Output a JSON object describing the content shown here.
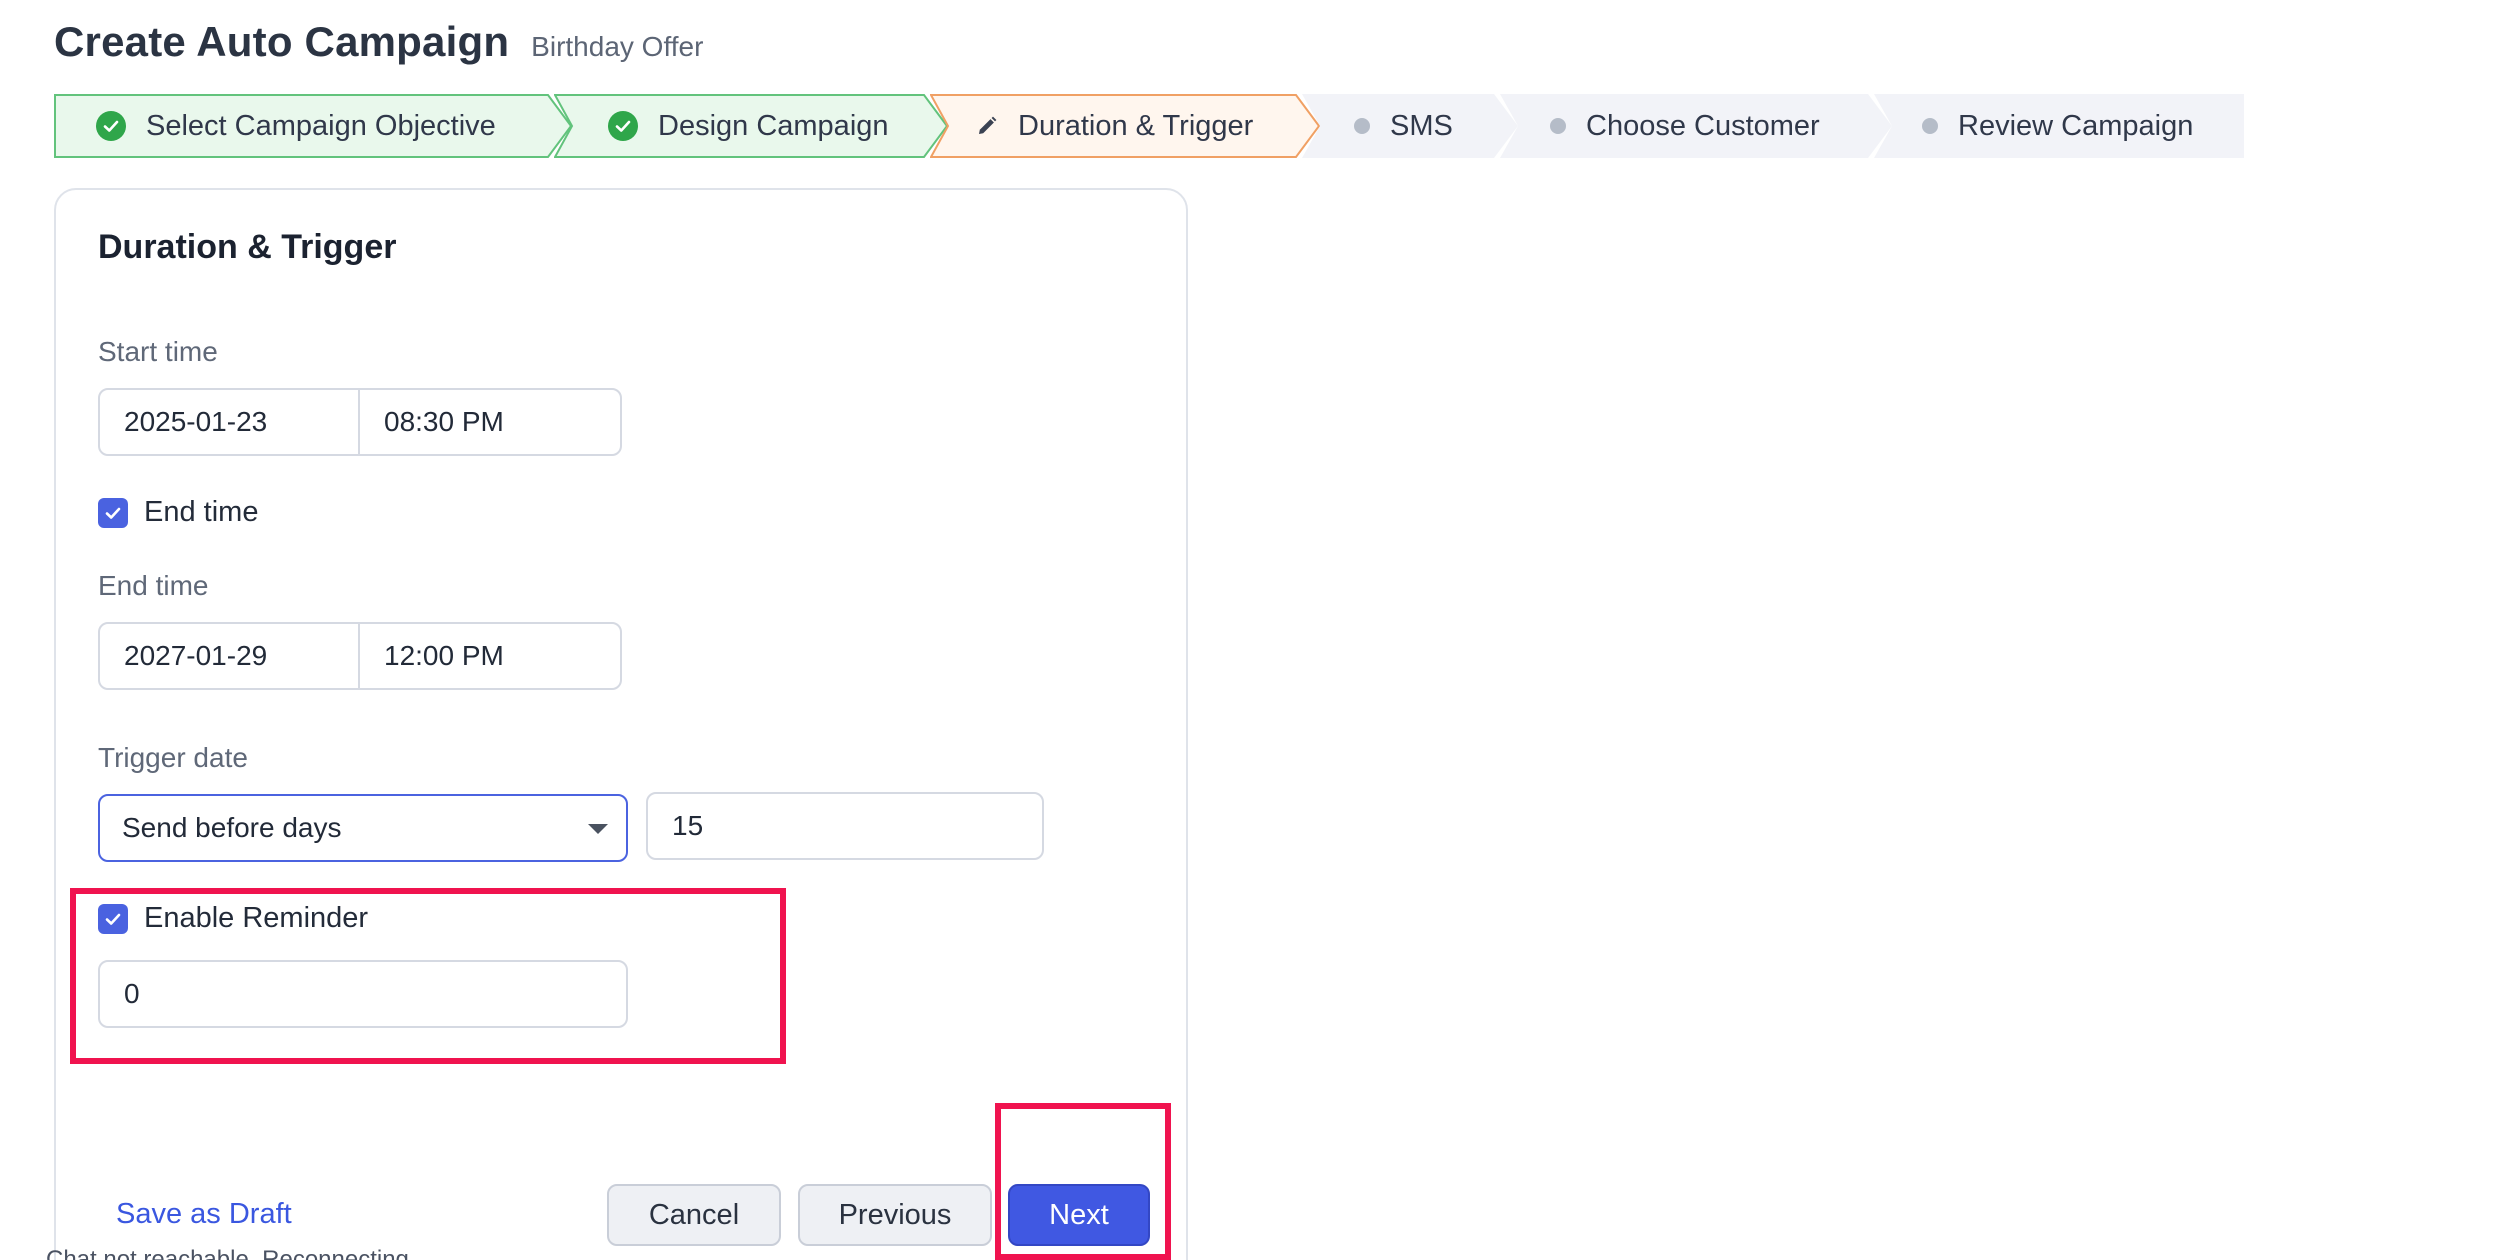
{
  "header": {
    "title": "Create Auto Campaign",
    "subtitle": "Birthday Offer"
  },
  "stepper": {
    "steps": [
      {
        "label": "Select Campaign Objective",
        "status": "completed"
      },
      {
        "label": "Design Campaign",
        "status": "completed"
      },
      {
        "label": "Duration & Trigger",
        "status": "active"
      },
      {
        "label": "SMS",
        "status": "pending"
      },
      {
        "label": "Choose Customer",
        "status": "pending"
      },
      {
        "label": "Review Campaign",
        "status": "pending"
      }
    ]
  },
  "form": {
    "section_title": "Duration & Trigger",
    "start": {
      "label": "Start time",
      "date": "2025-01-23",
      "time": "08:30 PM"
    },
    "end_toggle": {
      "label": "End time",
      "checked": true
    },
    "end": {
      "label": "End time",
      "date": "2027-01-29",
      "time": "12:00 PM"
    },
    "trigger": {
      "label": "Trigger date",
      "selected": "Send before days",
      "days": "15"
    },
    "reminder": {
      "label": "Enable Reminder",
      "checked": true,
      "value": "0"
    }
  },
  "footer": {
    "save_draft": "Save as Draft",
    "cancel": "Cancel",
    "previous": "Previous",
    "next": "Next"
  },
  "status_text": "Chat not reachable. Reconnecting...",
  "colors": {
    "accent": "#4058e2",
    "completed": "#2fa64a",
    "active_border": "#f0a064",
    "highlight": "#f0134f"
  }
}
